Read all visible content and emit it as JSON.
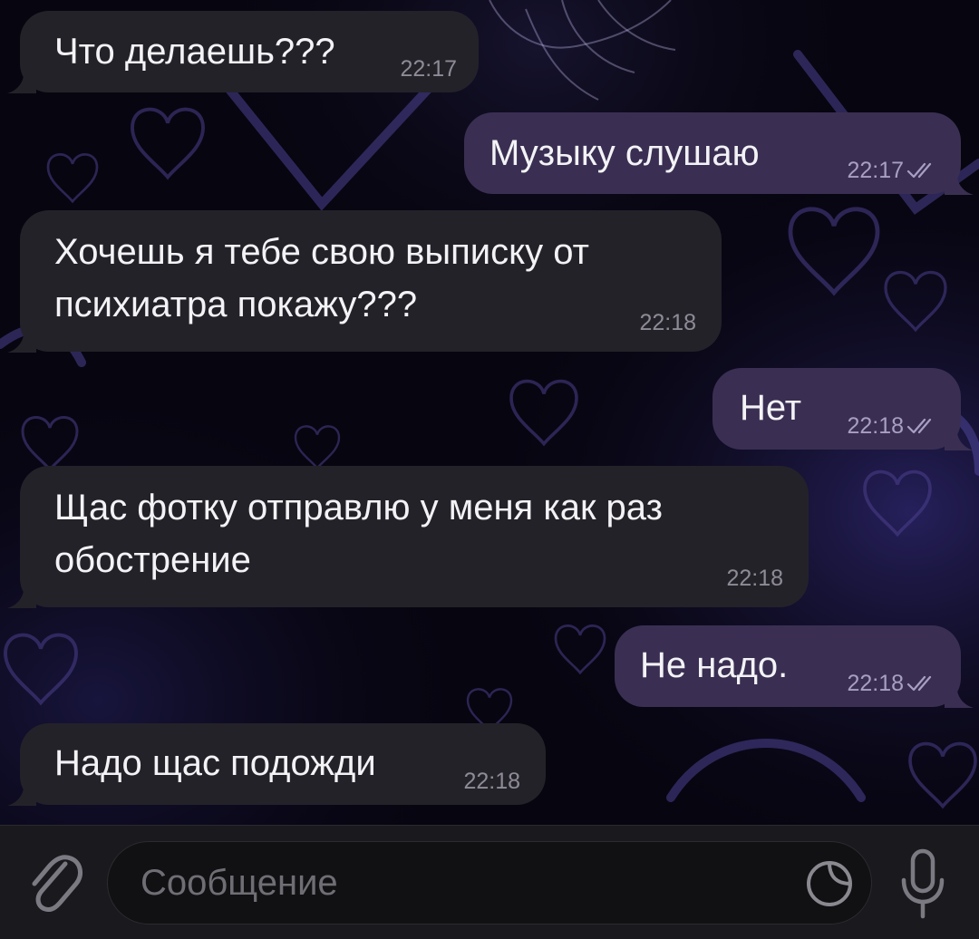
{
  "messages": [
    {
      "direction": "in",
      "lines": [
        "Что делаешь???"
      ],
      "time": "22:17"
    },
    {
      "direction": "out",
      "lines": [
        "Музыку слушаю"
      ],
      "time": "22:17",
      "status": "read"
    },
    {
      "direction": "in",
      "lines": [
        "Хочешь я тебе свою выписку от",
        "психиатра покажу???"
      ],
      "time": "22:18"
    },
    {
      "direction": "out",
      "lines": [
        "Нет"
      ],
      "time": "22:18",
      "status": "read"
    },
    {
      "direction": "in",
      "lines": [
        "Щас фотку отправлю у меня как раз",
        "обострение"
      ],
      "time": "22:18"
    },
    {
      "direction": "out",
      "lines": [
        "Не надо."
      ],
      "time": "22:18",
      "status": "read"
    },
    {
      "direction": "in",
      "lines": [
        "Надо щас подожди"
      ],
      "time": "22:18"
    }
  ],
  "composer": {
    "placeholder": "Сообщение",
    "value": ""
  },
  "icons": {
    "attach": "paperclip-icon",
    "sticker": "sticker-icon",
    "microphone": "microphone-icon",
    "read_status": "double-check-icon"
  },
  "colors": {
    "background": "#070510",
    "incoming_bubble": "#242229",
    "outgoing_bubble": "#3a2f52",
    "wallpaper_lines": "#4a3f8c"
  }
}
